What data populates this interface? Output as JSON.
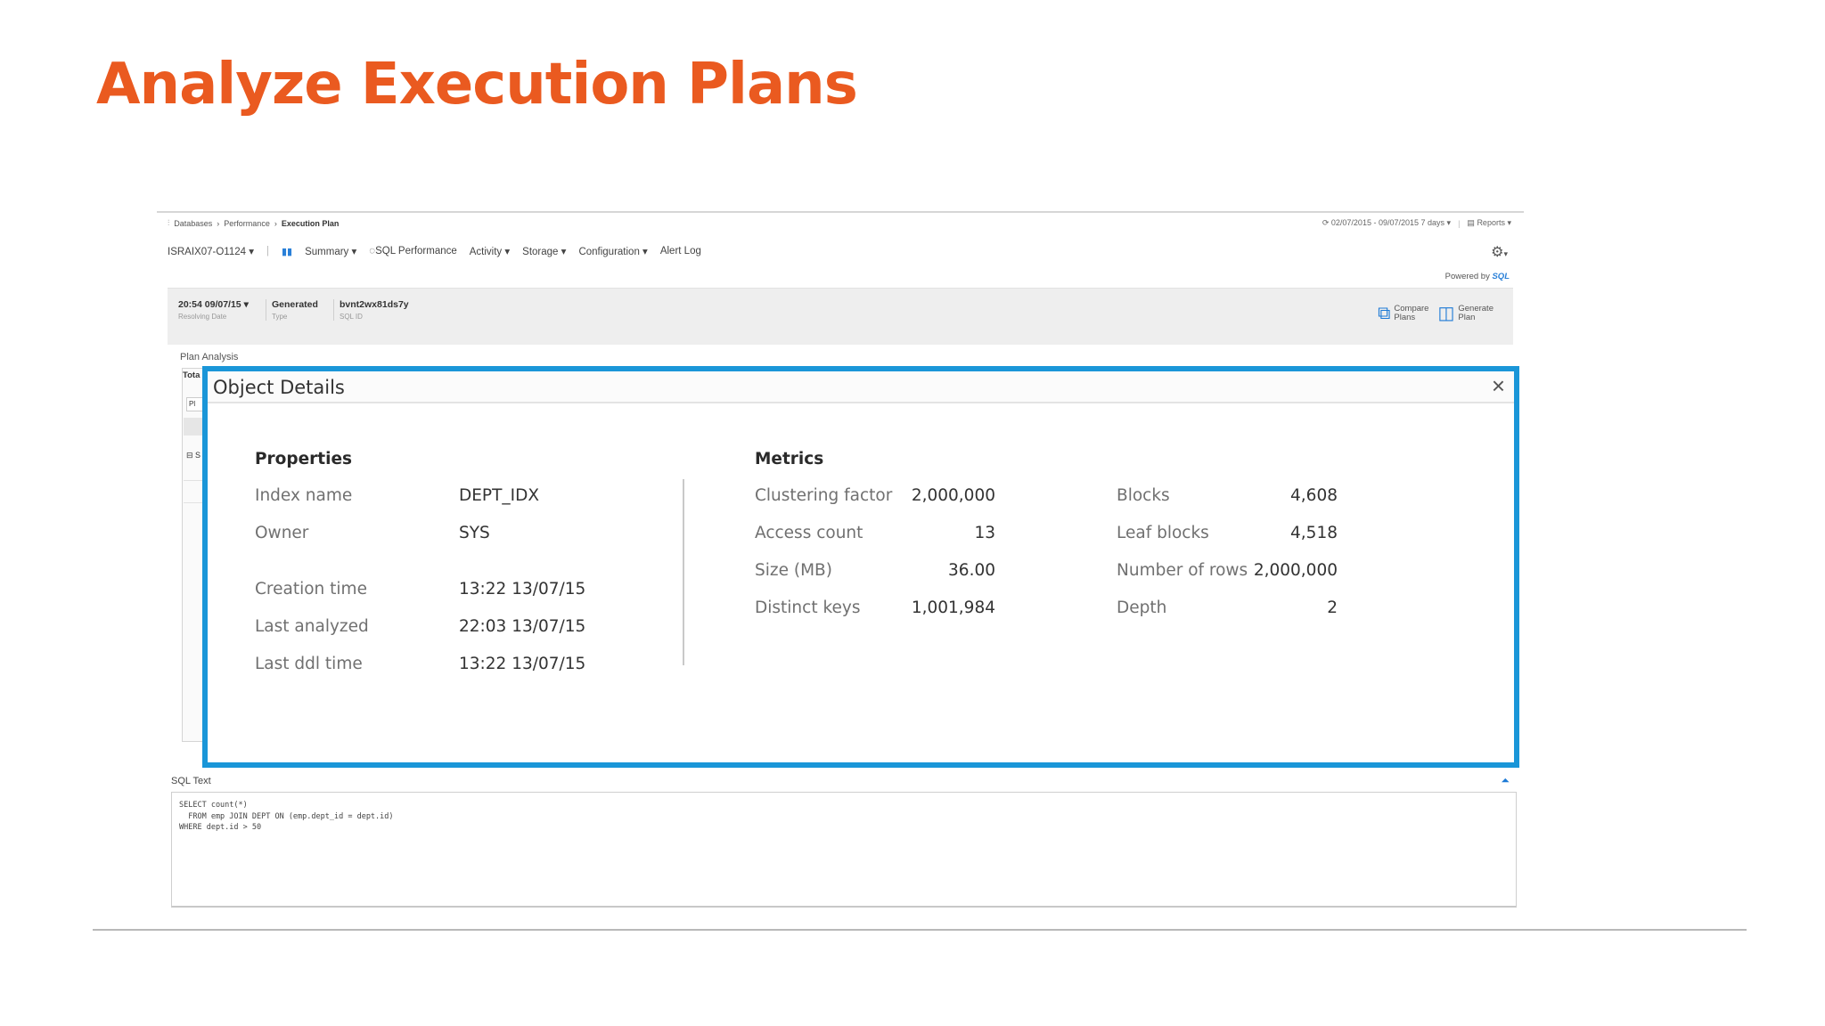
{
  "slide": {
    "title": "Analyze Execution Plans"
  },
  "app": {
    "breadcrumb": [
      "Databases",
      "Performance",
      "Execution Plan"
    ],
    "date_range": "02/07/2015 - 09/07/2015  7 days",
    "reports_label": "Reports",
    "nav": {
      "instance": "ISRAIX07-O1124",
      "items": [
        "Summary",
        "SQL Performance",
        "Activity",
        "Storage",
        "Configuration",
        "Alert Log"
      ]
    },
    "powered_by": {
      "prefix": "Powered by",
      "brand": "SQL"
    },
    "info": {
      "resolving_date": {
        "value": "20:54 09/07/15",
        "label": "Resolving Date"
      },
      "type": {
        "value": "Generated",
        "label": "Type"
      },
      "sql_id": {
        "value": "bvnt2wx81ds7y",
        "label": "SQL ID"
      },
      "actions": [
        {
          "line1": "Compare",
          "line2": "Plans"
        },
        {
          "line1": "Generate",
          "line2": "Plan"
        }
      ]
    },
    "plan_analysis_label": "Plan Analysis",
    "plan_left": {
      "a": "Tota",
      "b": "Pl",
      "d": "S"
    },
    "sql_text": {
      "label": "SQL Text",
      "lines": [
        "SELECT count(*)",
        "  FROM emp JOIN DEPT ON (emp.dept_id = dept.id)",
        "WHERE dept.id > 50"
      ]
    }
  },
  "modal": {
    "title": "Object Details",
    "properties": {
      "heading": "Properties",
      "rows": [
        {
          "label": "Index name",
          "value": "DEPT_IDX"
        },
        {
          "label": "Owner",
          "value": "SYS"
        },
        {
          "label": "Creation time",
          "value": "13:22 13/07/15"
        },
        {
          "label": "Last analyzed",
          "value": "22:03 13/07/15"
        },
        {
          "label": "Last ddl time",
          "value": "13:22 13/07/15"
        }
      ]
    },
    "metrics": {
      "heading": "Metrics",
      "col1": [
        {
          "label": "Clustering factor",
          "value": "2,000,000"
        },
        {
          "label": "Access count",
          "value": "13"
        },
        {
          "label": "Size (MB)",
          "value": "36.00"
        },
        {
          "label": "Distinct keys",
          "value": "1,001,984"
        }
      ],
      "col2": [
        {
          "label": "Blocks",
          "value": "4,608"
        },
        {
          "label": "Leaf blocks",
          "value": "4,518"
        },
        {
          "label": "Number of rows",
          "value": "2,000,000"
        },
        {
          "label": "Depth",
          "value": "2"
        }
      ]
    }
  },
  "colors": {
    "title": "#ea5a20",
    "modal_border": "#1a96d8",
    "accent_blue": "#1d7ad6"
  }
}
